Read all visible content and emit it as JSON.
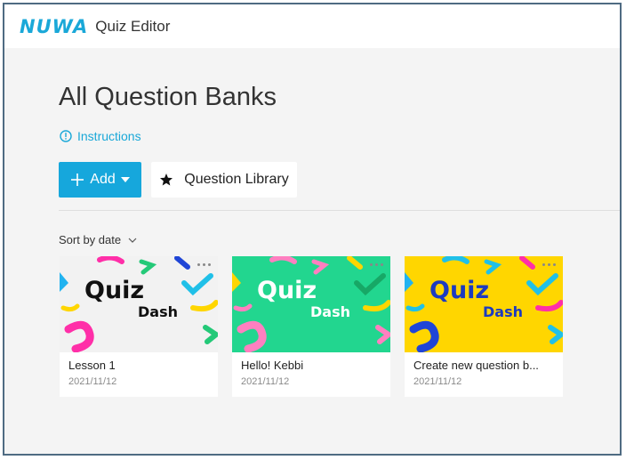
{
  "header": {
    "logo_text": "NUWA",
    "app_title": "Quiz Editor"
  },
  "page": {
    "title": "All Question Banks",
    "instructions_label": "Instructions"
  },
  "toolbar": {
    "add_label": "Add",
    "library_label": "Question Library"
  },
  "sort": {
    "label": "Sort by date"
  },
  "thumbnail": {
    "line1": "Quiz",
    "line2": "Dash"
  },
  "cards": [
    {
      "name": "Lesson 1",
      "date": "2021/11/12",
      "theme_bg": "#f2f2f2",
      "theme_title": "#111111"
    },
    {
      "name": "Hello! Kebbi",
      "date": "2021/11/12",
      "theme_bg": "#22d68f",
      "theme_title": "#ffffff"
    },
    {
      "name": "Create new question b...",
      "date": "2021/11/12",
      "theme_bg": "#ffd600",
      "theme_title": "#1d3bbf"
    }
  ],
  "colors": {
    "accent": "#16a7dc",
    "frame_border": "#4f6b82"
  },
  "icons": {
    "instructions": "info-circle-icon",
    "add": "plus-icon",
    "add_caret": "caret-down-icon",
    "library": "star-icon",
    "sort": "chevron-down-icon",
    "card_menu": "more-dots-icon"
  }
}
